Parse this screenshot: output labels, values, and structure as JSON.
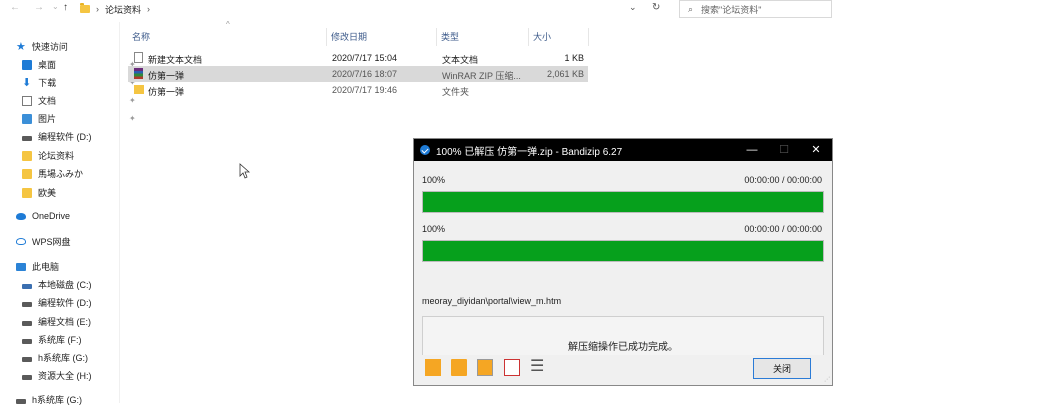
{
  "address": {
    "path": "论坛资料",
    "search_placeholder": "搜索\"论坛资料\""
  },
  "sidebar": {
    "items": [
      {
        "label": "快速访问"
      },
      {
        "label": "桌面"
      },
      {
        "label": "下载"
      },
      {
        "label": "文档"
      },
      {
        "label": "图片"
      },
      {
        "label": "编程软件 (D:)"
      },
      {
        "label": "论坛资料"
      },
      {
        "label": "馬場ふみか"
      },
      {
        "label": "欧美"
      },
      {
        "label": "OneDrive"
      },
      {
        "label": "WPS网盘"
      },
      {
        "label": "此电脑"
      },
      {
        "label": "本地磁盘 (C:)"
      },
      {
        "label": "编程软件 (D:)"
      },
      {
        "label": "编程文档 (E:)"
      },
      {
        "label": "系统库 (F:)"
      },
      {
        "label": "h系统库 (G:)"
      },
      {
        "label": "资源大全 (H:)"
      },
      {
        "label": "h系统库 (G:)"
      }
    ]
  },
  "file_list": {
    "headers": {
      "name": "名称",
      "date": "修改日期",
      "type": "类型",
      "size": "大小"
    },
    "rows": [
      {
        "name": "新建文本文档",
        "date": "2020/7/17 15:04",
        "type": "文本文档",
        "size": "1 KB"
      },
      {
        "name": "仿第一弹",
        "date": "2020/7/16 18:07",
        "type": "WinRAR ZIP 压缩...",
        "size": "2,061 KB"
      },
      {
        "name": "仿第一弹",
        "date": "2020/7/17 19:46",
        "type": "文件夹",
        "size": ""
      }
    ]
  },
  "dialog": {
    "title": "100% 已解压 仿第一弹.zip - Bandizip 6.27",
    "progress1": {
      "percent_text": "100%",
      "time": "00:00:00 / 00:00:00",
      "fill": 1.0
    },
    "progress2": {
      "percent_text": "100%",
      "time": "00:00:00 / 00:00:00",
      "fill": 1.0
    },
    "current_file": "meoray_diyidan\\portal\\view_m.htm",
    "message": "解压缩操作已成功完成。",
    "close_label": "关闭"
  }
}
